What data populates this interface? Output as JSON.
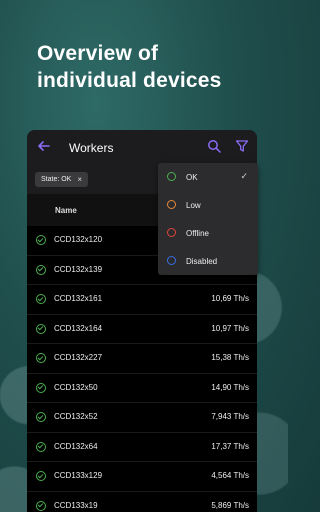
{
  "headline": [
    "Overview of",
    "individual devices"
  ],
  "appbar": {
    "title": "Workers"
  },
  "filter_chip": {
    "label": "State: OK",
    "close": "×"
  },
  "table": {
    "column_name": "Name",
    "rows": [
      {
        "name": "CCD132x120",
        "rate": ""
      },
      {
        "name": "CCD132x139",
        "rate": ""
      },
      {
        "name": "CCD132x161",
        "rate": "10,69 Th/s"
      },
      {
        "name": "CCD132x164",
        "rate": "10,97 Th/s"
      },
      {
        "name": "CCD132x227",
        "rate": "15,38 Th/s"
      },
      {
        "name": "CCD132x50",
        "rate": "14,90 Th/s"
      },
      {
        "name": "CCD132x52",
        "rate": "7,943 Th/s"
      },
      {
        "name": "CCD132x64",
        "rate": "17,37 Th/s"
      },
      {
        "name": "CCD133x129",
        "rate": "4,564 Th/s"
      },
      {
        "name": "CCD133x19",
        "rate": "5,869 Th/s"
      }
    ]
  },
  "menu": {
    "items": [
      {
        "label": "OK",
        "checked": true,
        "color": "#4caf50"
      },
      {
        "label": "Low",
        "checked": false,
        "color": "#e8883a"
      },
      {
        "label": "Offline",
        "checked": false,
        "color": "#e0443b"
      },
      {
        "label": "Disabled",
        "checked": false,
        "color": "#3a6fe0"
      }
    ],
    "check_glyph": "✓"
  },
  "colors": {
    "accent": "#8b6cf6",
    "ok": "#4caf50"
  }
}
